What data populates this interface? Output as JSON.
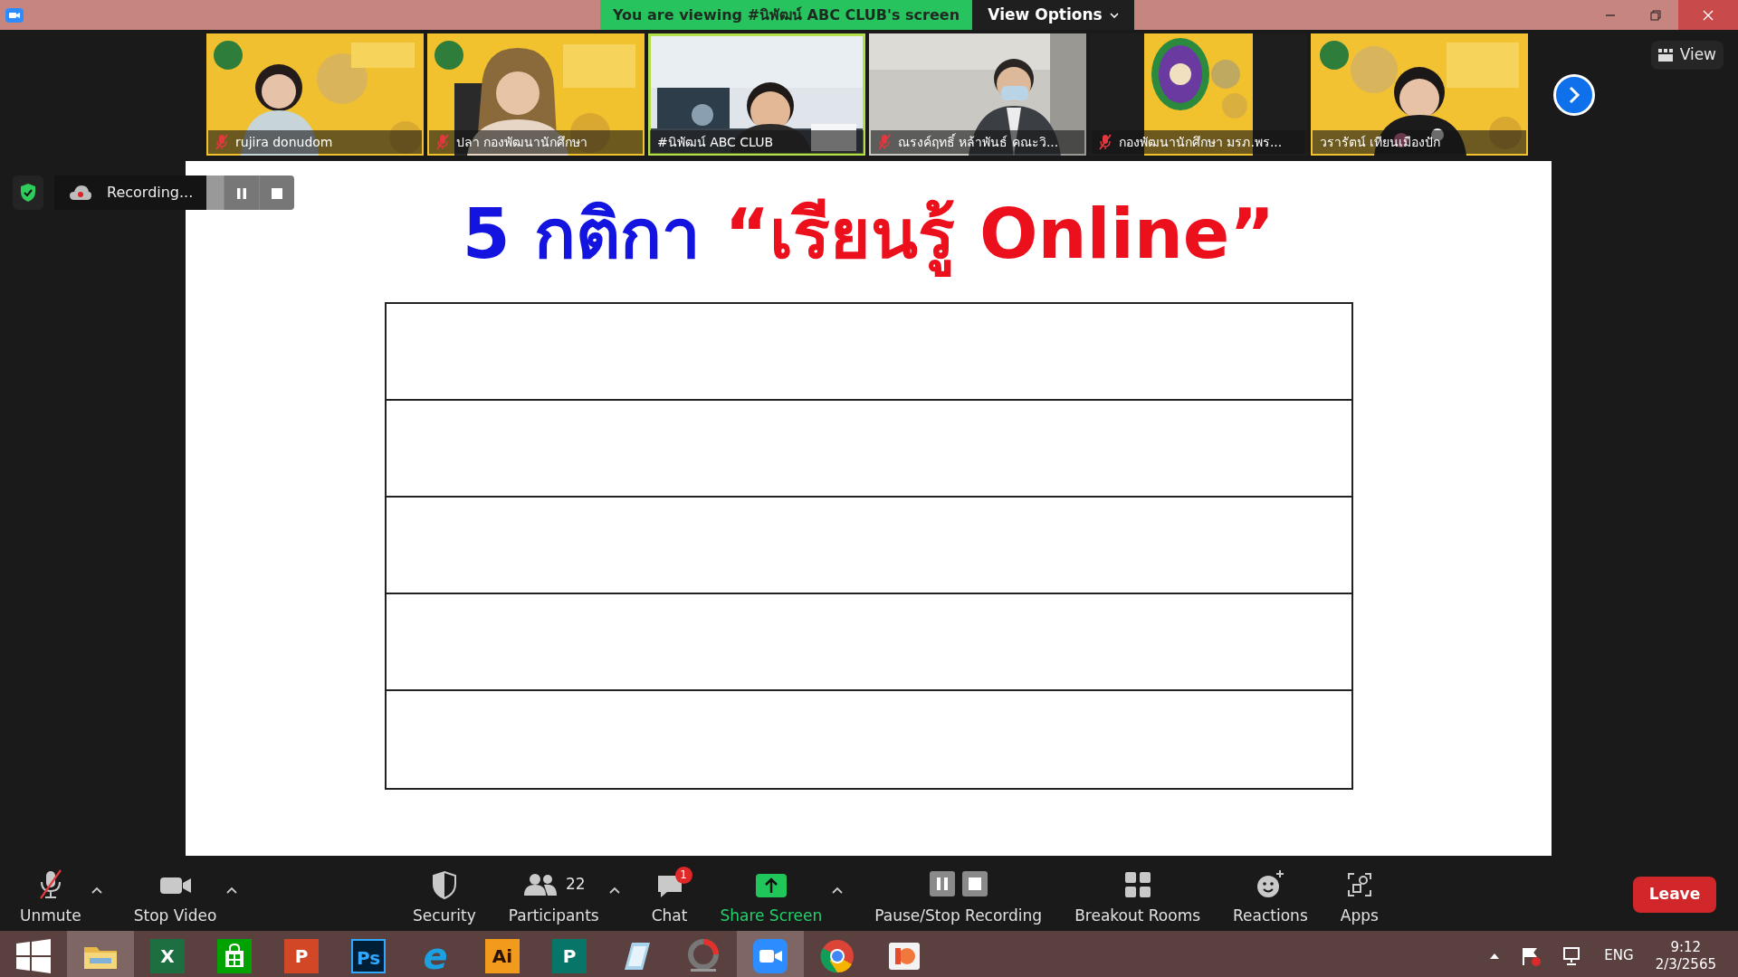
{
  "title_bar": {
    "banner": "You are viewing #นิพัฒน์ ABC CLUB's screen",
    "view_options": "View Options"
  },
  "thumbnails": [
    {
      "name": "rujira donudom",
      "muted": true,
      "speaking": false,
      "kind": "picture"
    },
    {
      "name": "ปลา กองพัฒนานักศึกษา",
      "muted": true,
      "speaking": false,
      "kind": "picture"
    },
    {
      "name": "#นิพัฒน์ ABC CLUB",
      "muted": false,
      "speaking": true,
      "kind": "picture"
    },
    {
      "name": "ณรงค์ฤทธิ์ หล้าพันธ์ คณะวิ...",
      "muted": true,
      "speaking": false,
      "kind": "picture"
    },
    {
      "name": "กองพัฒนานักศึกษา มรภ.พร...",
      "muted": true,
      "speaking": false,
      "kind": "picture"
    },
    {
      "name": "วรารัตน์ เทียนเมืองปัก",
      "muted": false,
      "speaking": false,
      "kind": "picture"
    }
  ],
  "view_button": "View",
  "recording": {
    "label": "Recording..."
  },
  "slide": {
    "title": [
      {
        "text": "5 กติกา",
        "color": "#1414e0"
      },
      {
        "text": "“เรียนรู้ Online”",
        "color": "#ec0f1c"
      }
    ],
    "table": {
      "rows": [
        {
          "kind": "blank"
        },
        {
          "kind": "blank"
        },
        {
          "kind": "blank"
        },
        {
          "kind": "blank"
        },
        {
          "kind": "blank"
        }
      ]
    }
  },
  "toolbar": {
    "left": [
      {
        "kind": "mic",
        "label": "Unmute",
        "menu": true
      },
      {
        "kind": "video",
        "label": "Stop Video",
        "menu": true
      }
    ],
    "center": [
      {
        "kind": "security",
        "label": "Security",
        "menu": false
      },
      {
        "kind": "participants",
        "label": "Participants",
        "count": "22",
        "menu": true
      },
      {
        "kind": "chat",
        "label": "Chat",
        "badge": "1",
        "menu": false
      },
      {
        "kind": "share",
        "label": "Share Screen",
        "menu": true
      },
      {
        "kind": "recording",
        "label": "Pause/Stop Recording",
        "menu": false
      },
      {
        "kind": "breakout",
        "label": "Breakout Rooms",
        "menu": false
      },
      {
        "kind": "reactions",
        "label": "Reactions",
        "menu": false
      },
      {
        "kind": "apps",
        "label": "Apps",
        "menu": false
      }
    ],
    "leave": "Leave"
  },
  "taskbar": {
    "items": [
      {
        "kind": "folder",
        "selected": true
      },
      {
        "kind": "excel",
        "letter": "X",
        "selected": false
      },
      {
        "kind": "store",
        "selected": false
      },
      {
        "kind": "powerpoint",
        "letter": "P",
        "selected": false
      },
      {
        "kind": "photoshop",
        "letter": "Ps",
        "selected": false
      },
      {
        "kind": "ie",
        "letter": "e",
        "selected": false
      },
      {
        "kind": "illustrator",
        "letter": "Ai",
        "selected": false
      },
      {
        "kind": "publisher",
        "letter": "P",
        "selected": false
      },
      {
        "kind": "notepad",
        "selected": false
      },
      {
        "kind": "photoscape",
        "selected": false
      },
      {
        "kind": "zoom",
        "selected": true
      },
      {
        "kind": "chrome",
        "selected": false
      },
      {
        "kind": "paint",
        "selected": false
      }
    ],
    "language": "ENG",
    "time": "9:12",
    "date": "2/3/2565"
  }
}
